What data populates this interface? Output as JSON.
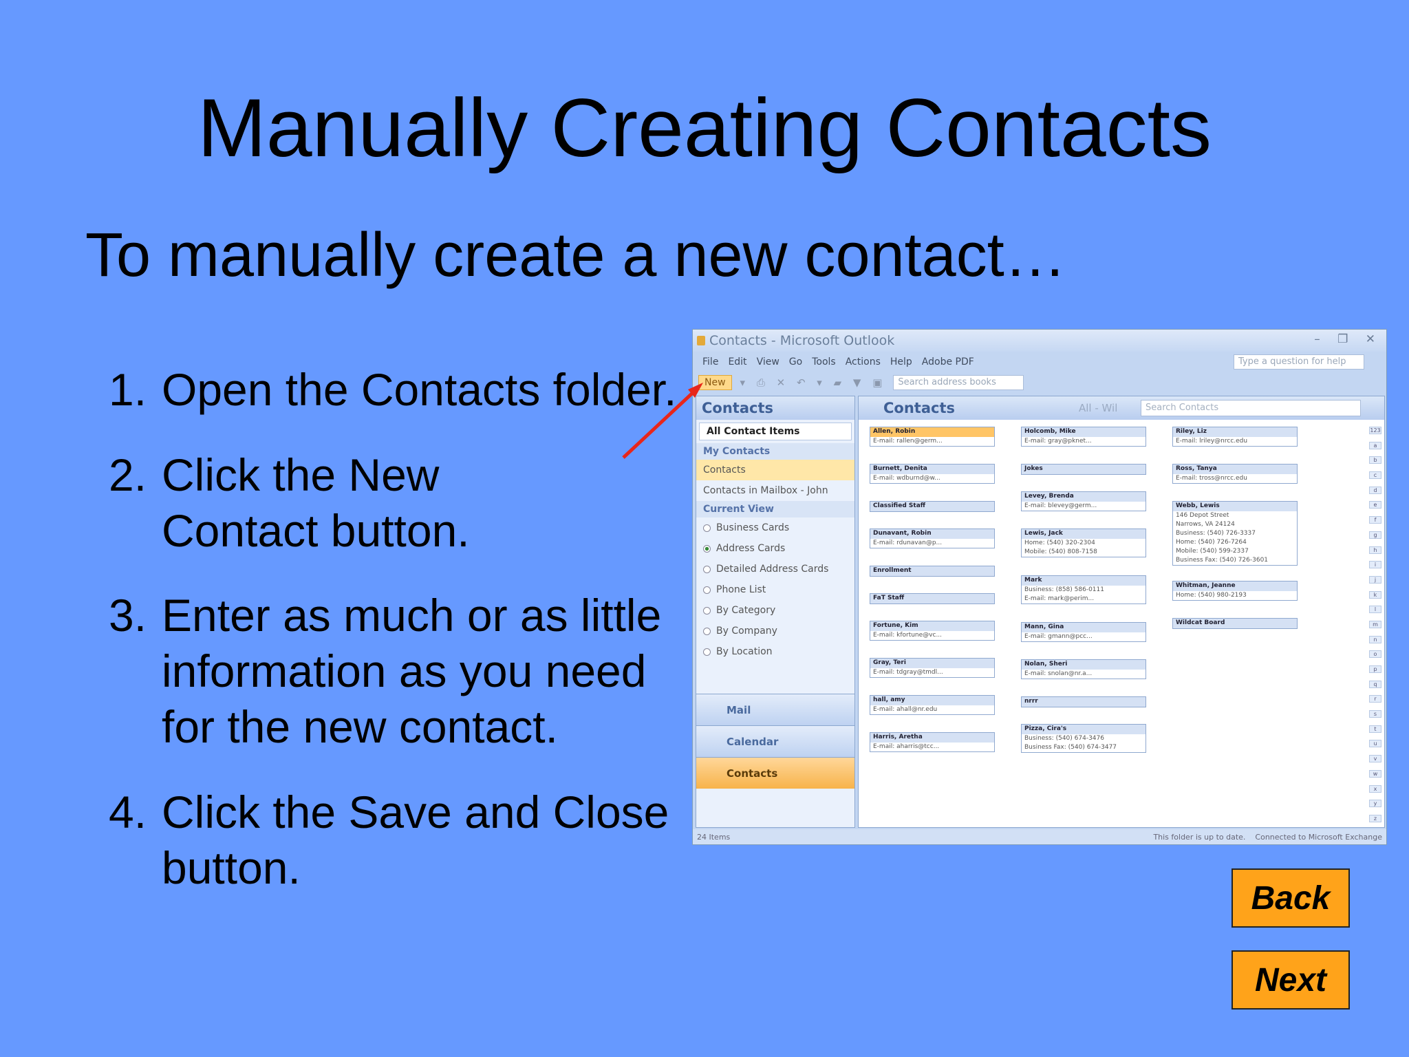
{
  "slide": {
    "title": "Manually Creating Contacts",
    "subtitle": "To manually create a new contact…",
    "steps": [
      {
        "num": "1.",
        "text": "Open the Contacts folder."
      },
      {
        "num": "2.",
        "text": "Click the New Contact button."
      },
      {
        "num": "3.",
        "text": "Enter as much or as little information as you need for the new contact."
      },
      {
        "num": "4.",
        "text": "Click the Save and Close button."
      }
    ],
    "buttons": {
      "back": "Back",
      "next": "Next"
    },
    "colors": {
      "background": "#6699ff",
      "button": "#ffa31a",
      "arrow": "#e8261a"
    }
  },
  "outlook": {
    "window_title": "Contacts - Microsoft Outlook",
    "window_controls": "– ❐ ✕",
    "menu": [
      "File",
      "Edit",
      "View",
      "Go",
      "Tools",
      "Actions",
      "Help",
      "Adobe PDF"
    ],
    "help_placeholder": "Type a question for help",
    "toolbar": {
      "new_label": "New",
      "search_placeholder": "Search address books"
    },
    "nav": {
      "header": "Contacts",
      "all_items": "All Contact Items",
      "my_contacts_group": "My Contacts",
      "folders": [
        "Contacts",
        "Contacts in Mailbox - John"
      ],
      "current_view_group": "Current View",
      "views": [
        "Business Cards",
        "Address Cards",
        "Detailed Address Cards",
        "Phone List",
        "By Category",
        "By Company",
        "By Location"
      ],
      "selected_view": "Address Cards",
      "panes": [
        "Mail",
        "Calendar",
        "Contacts"
      ]
    },
    "main": {
      "header": "Contacts",
      "range": "All - Wil",
      "search_placeholder": "Search Contacts",
      "columns": [
        [
          {
            "name": "Allen, Robin",
            "lines": [
              "E-mail:   rallen@germ..."
            ],
            "selected": true
          },
          {
            "name": "Burnett, Denita",
            "lines": [
              "E-mail:   wdburnd@w..."
            ]
          },
          {
            "name": "Classified Staff",
            "lines": []
          },
          {
            "name": "Dunavant, Robin",
            "lines": [
              "E-mail:   rdunavan@p..."
            ]
          },
          {
            "name": "Enrollment",
            "lines": []
          },
          {
            "name": "FaT Staff",
            "lines": []
          },
          {
            "name": "Fortune, Kim",
            "lines": [
              "E-mail:   kfortune@vc..."
            ]
          },
          {
            "name": "Gray, Teri",
            "lines": [
              "E-mail:   tdgray@tmdl..."
            ]
          },
          {
            "name": "hall, amy",
            "lines": [
              "E-mail:   ahall@nr.edu"
            ]
          },
          {
            "name": "Harris, Aretha",
            "lines": [
              "E-mail:   aharris@tcc..."
            ]
          }
        ],
        [
          {
            "name": "Holcomb, Mike",
            "lines": [
              "E-mail:   gray@pknet..."
            ]
          },
          {
            "name": "Jokes",
            "lines": []
          },
          {
            "name": "Levey, Brenda",
            "lines": [
              "E-mail:   blevey@germ..."
            ]
          },
          {
            "name": "Lewis, Jack",
            "lines": [
              "Home:   (540) 320-2304",
              "Mobile:   (540) 808-7158"
            ]
          },
          {
            "name": "Mark",
            "lines": [
              "Business:   (858) 586-0111",
              "E-mail:   mark@perim..."
            ]
          },
          {
            "name": "Mann, Gina",
            "lines": [
              "E-mail:   gmann@pcc..."
            ]
          },
          {
            "name": "Nolan, Sheri",
            "lines": [
              "E-mail:   snolan@nr.a..."
            ]
          },
          {
            "name": "nrrr",
            "lines": []
          },
          {
            "name": "Pizza, Cira's",
            "lines": [
              "Business:   (540) 674-3476",
              "Business Fax:   (540) 674-3477"
            ]
          }
        ],
        [
          {
            "name": "Riley, Liz",
            "lines": [
              "E-mail:   lriley@nrcc.edu"
            ]
          },
          {
            "name": "Ross, Tanya",
            "lines": [
              "E-mail:   tross@nrcc.edu"
            ]
          },
          {
            "name": "Webb, Lewis",
            "lines": [
              "146 Depot Street",
              "Narrows, VA 24124",
              "Business:   (540) 726-3337",
              "Home:   (540) 726-7264",
              "Mobile:   (540) 599-2337",
              "Business Fax:   (540) 726-3601"
            ]
          },
          {
            "name": "Whitman, Jeanne",
            "lines": [
              "Home:   (540) 980-2193"
            ]
          },
          {
            "name": "Wildcat Board",
            "lines": []
          }
        ]
      ],
      "alphabet": [
        "123",
        "a",
        "b",
        "c",
        "d",
        "e",
        "f",
        "g",
        "h",
        "i",
        "j",
        "k",
        "l",
        "m",
        "n",
        "o",
        "p",
        "q",
        "r",
        "s",
        "t",
        "u",
        "v",
        "w",
        "x",
        "y",
        "z"
      ]
    },
    "status": {
      "items": "24 Items",
      "folder_status": "This folder is up to date.",
      "connection": "Connected to Microsoft Exchange"
    }
  }
}
